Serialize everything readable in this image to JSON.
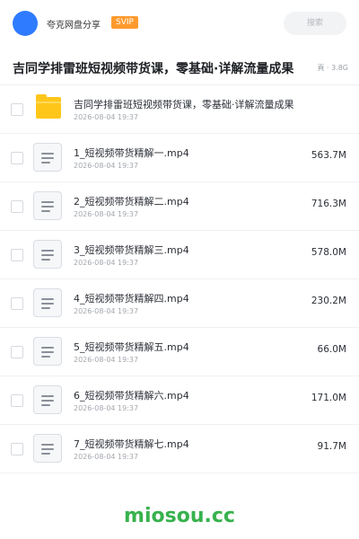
{
  "header": {
    "owner_name": "夸克网盘分享",
    "badge": "SVIP",
    "search_placeholder": "搜索"
  },
  "share": {
    "title": "吉同学排雷班短视频带货课，零基础·详解流量成果",
    "meta": "頁 · 3.8G"
  },
  "items": [
    {
      "type": "folder",
      "name": "吉同学排雷班短视频带货课，零基础·详解流量成果",
      "date": "2026-08-04 19:37",
      "size": ""
    },
    {
      "type": "file",
      "name": "1_短视频带货精解一.mp4",
      "date": "2026-08-04 19:37",
      "size": "563.7M"
    },
    {
      "type": "file",
      "name": "2_短视频带货精解二.mp4",
      "date": "2026-08-04 19:37",
      "size": "716.3M"
    },
    {
      "type": "file",
      "name": "3_短视频带货精解三.mp4",
      "date": "2026-08-04 19:37",
      "size": "578.0M"
    },
    {
      "type": "file",
      "name": "4_短视频带货精解四.mp4",
      "date": "2026-08-04 19:37",
      "size": "230.2M"
    },
    {
      "type": "file",
      "name": "5_短视频带货精解五.mp4",
      "date": "2026-08-04 19:37",
      "size": "66.0M"
    },
    {
      "type": "file",
      "name": "6_短视频带货精解六.mp4",
      "date": "2026-08-04 19:37",
      "size": "171.0M"
    },
    {
      "type": "file",
      "name": "7_短视频带货精解七.mp4",
      "date": "2026-08-04 19:37",
      "size": "91.7M"
    }
  ],
  "watermark": "miosou.cc",
  "colors": {
    "avatar": "#2f7bff",
    "badge": "#ff9a2e",
    "folder": "#ffc61a",
    "watermark": "#37b24d"
  }
}
